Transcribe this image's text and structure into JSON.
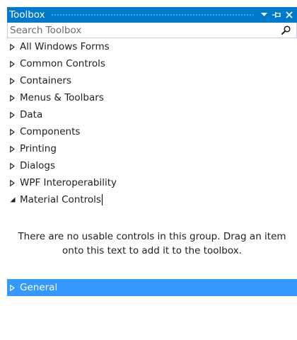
{
  "panel": {
    "title": "Toolbox"
  },
  "search": {
    "placeholder": "Search Toolbox"
  },
  "groups": [
    {
      "label": "All Windows Forms",
      "expanded": false
    },
    {
      "label": "Common Controls",
      "expanded": false
    },
    {
      "label": "Containers",
      "expanded": false
    },
    {
      "label": "Menus & Toolbars",
      "expanded": false
    },
    {
      "label": "Data",
      "expanded": false
    },
    {
      "label": "Components",
      "expanded": false
    },
    {
      "label": "Printing",
      "expanded": false
    },
    {
      "label": "Dialogs",
      "expanded": false
    },
    {
      "label": "WPF Interoperability",
      "expanded": false
    },
    {
      "label": "Material Controls",
      "expanded": true
    }
  ],
  "empty_message": "There are no usable controls in this group. Drag an item onto this text to add it to the toolbox.",
  "selected_group": {
    "label": "General",
    "expanded": false
  },
  "colors": {
    "title_bar": "#007acc",
    "selection": "#3399ff",
    "text": "#1e1e1e"
  },
  "icons": {
    "collapsed": "collapsed-arrow-icon",
    "expanded": "expanded-arrow-icon",
    "dropdown": "chevron-down-icon",
    "pin": "pin-icon",
    "close": "close-icon",
    "search": "search-icon"
  }
}
